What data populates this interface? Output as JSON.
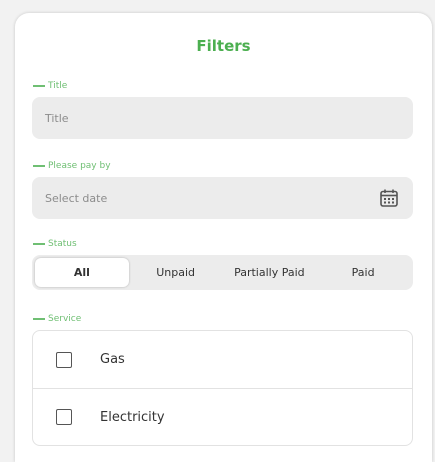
{
  "filters": {
    "title": "Filters",
    "accent_color": "#4caf50",
    "title_field": {
      "label": "Title",
      "placeholder": "Title"
    },
    "pay_by_field": {
      "label": "Please pay by",
      "placeholder": "Select date",
      "icon": "calendar-icon"
    },
    "status": {
      "label": "Status",
      "options": [
        "All",
        "Unpaid",
        "Partially Paid",
        "Paid"
      ],
      "selected": "All"
    },
    "service": {
      "label": "Service",
      "items": [
        {
          "label": "Gas",
          "checked": false
        },
        {
          "label": "Electricity",
          "checked": false
        }
      ]
    }
  }
}
